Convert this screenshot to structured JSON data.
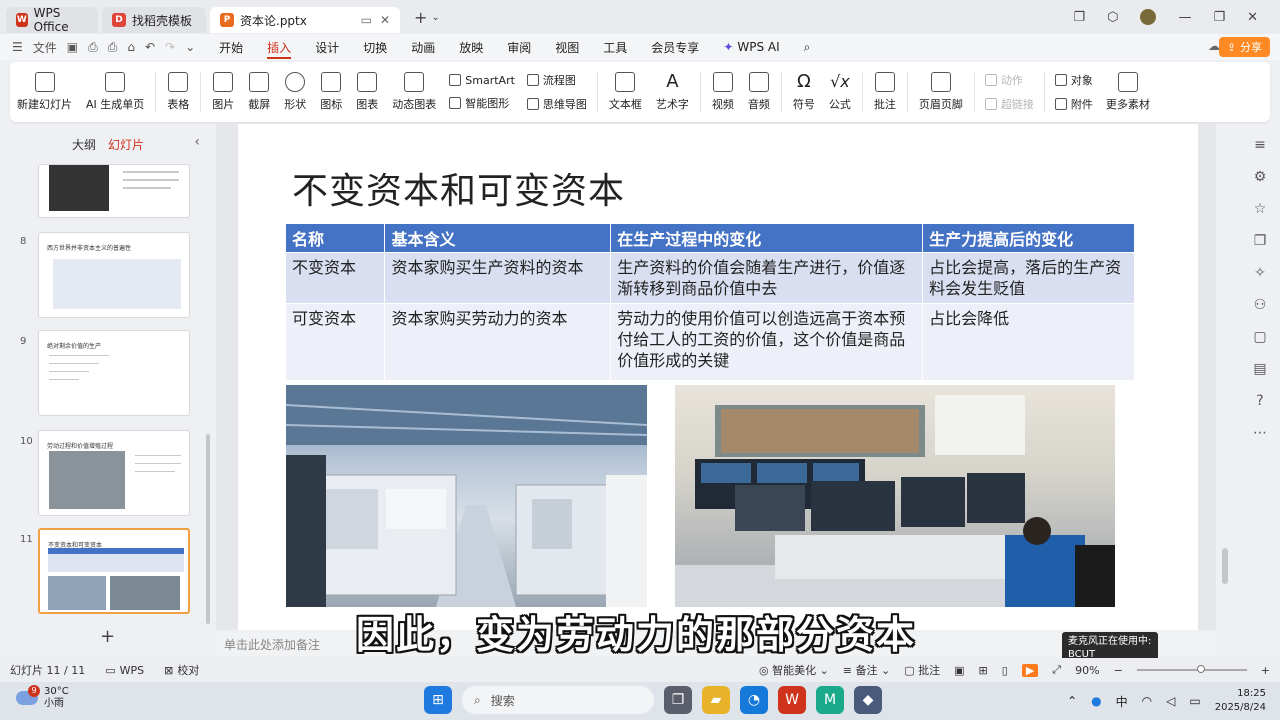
{
  "tabs": {
    "home": "WPS Office",
    "template": "找稻壳模板",
    "document": "资本论.pptx"
  },
  "menu": {
    "file": "文件",
    "items": [
      "开始",
      "插入",
      "设计",
      "切换",
      "动画",
      "放映",
      "审阅",
      "视图",
      "工具",
      "会员专享"
    ],
    "active": "插入",
    "ai": "WPS AI",
    "share": "分享"
  },
  "ribbon": {
    "new_slide": "新建幻灯片",
    "ai_slide": "AI 生成单页",
    "table": "表格",
    "picture": "图片",
    "screenshot": "截屏",
    "shape": "形状",
    "icon": "图标",
    "chart": "图表",
    "dynamic_chart": "动态图表",
    "smartart": "SmartArt",
    "smart_graphic": "智能图形",
    "flowchart": "流程图",
    "mindmap": "思维导图",
    "textbox": "文本框",
    "wordart": "艺术字",
    "video": "视频",
    "audio": "音频",
    "symbol": "符号",
    "formula": "公式",
    "comment": "批注",
    "header_footer": "页眉页脚",
    "action": "动作",
    "hyperlink": "超链接",
    "object": "对象",
    "attachment": "附件",
    "more": "更多素材"
  },
  "left_panel": {
    "tab_outline": "大纲",
    "tab_slides": "幻灯片",
    "slides": [
      {
        "num": "",
        "title": ""
      },
      {
        "num": "8",
        "title": "西方世界并非资本主义的普遍性"
      },
      {
        "num": "9",
        "title": "绝对剩余价值的生产"
      },
      {
        "num": "10",
        "title": "劳动过程和价值增殖过程"
      },
      {
        "num": "11",
        "title": "不变资本和可变资本"
      }
    ]
  },
  "slide": {
    "title": "不变资本和可变资本",
    "table": {
      "headers": [
        "名称",
        "基本含义",
        "在生产过程中的变化",
        "生产力提高后的变化"
      ],
      "rows": [
        [
          "不变资本",
          "资本家购买生产资料的资本",
          "生产资料的价值会随着生产进行，价值逐渐转移到商品价值中去",
          "占比会提高，落后的生产资料会发生贬值"
        ],
        [
          "可变资本",
          "资本家购买劳动力的资本",
          "劳动力的使用价值可以创造远高于资本预付给工人的工资的价值，这个价值是商品价值形成的关键",
          "占比会降低"
        ]
      ]
    }
  },
  "notes_placeholder": "单击此处添加备注",
  "subtitle": "因此，变为劳动力的那部分资本",
  "status": {
    "slide_count": "幻灯片 11 / 11",
    "wps": "WPS",
    "proof": "校对",
    "beautify": "智能美化",
    "notes": "备注",
    "comments": "批注",
    "zoom": "90%"
  },
  "tooltip": {
    "line1": "麦克风正在使用中:",
    "line2": "BCUT"
  },
  "taskbar": {
    "temp": "30°C",
    "weather": "小雨",
    "weather_badge": "9",
    "search": "搜索",
    "ime": "中",
    "time": "18:25",
    "date": "2025/8/24"
  },
  "colors": {
    "accent": "#d0331c",
    "table_header": "#4472c4",
    "row1": "#d9dff0",
    "row2": "#edf0f8",
    "share": "#ff8a24"
  }
}
